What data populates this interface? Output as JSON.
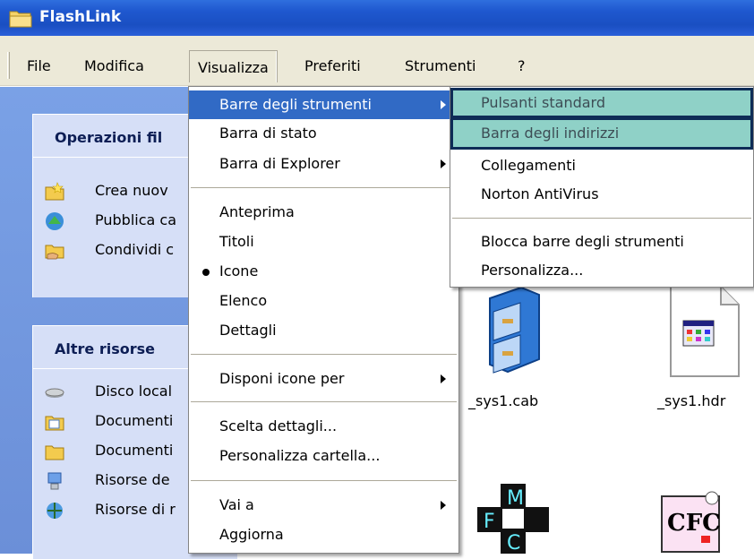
{
  "window": {
    "title": "FlashLink",
    "icon": "folder-icon"
  },
  "menubar": {
    "items": [
      "File",
      "Modifica",
      "Visualizza",
      "Preferiti",
      "Strumenti",
      "?"
    ]
  },
  "left_pane": {
    "tasks_header": "Operazioni fil",
    "tasks": [
      "Crea nuov",
      "Pubblica ca",
      "Condividi c"
    ],
    "other_header": "Altre risorse",
    "other": [
      "Disco local",
      "Documenti",
      "Documenti",
      "Risorse de",
      "Risorse di r"
    ]
  },
  "view_menu": {
    "items": [
      "Barre degli strumenti",
      "Barra di stato",
      "Barra di Explorer",
      "Anteprima",
      "Titoli",
      "Icone",
      "Elenco",
      "Dettagli",
      "Disponi icone per",
      "Scelta dettagli...",
      "Personalizza cartella...",
      "Vai a",
      "Aggiorna"
    ],
    "selected": "Barre degli strumenti",
    "checked": "Icone"
  },
  "toolbars_submenu": {
    "items": [
      "Pulsanti standard",
      "Barra degli indirizzi",
      "Collegamenti",
      "Norton AntiVirus",
      "Blocca barre degli strumenti",
      "Personalizza..."
    ],
    "highlighted": [
      "Pulsanti standard",
      "Barra degli indirizzi"
    ]
  },
  "files": [
    {
      "name": "_sys1.cab"
    },
    {
      "name": "_sys1.hdr"
    }
  ],
  "colors": {
    "title_bar": "#1f58cf",
    "menu_selection": "#316ac5",
    "highlight": "#8fd1c7",
    "highlight_border": "#0e2c56",
    "left_pane": "#6b8fd8"
  }
}
